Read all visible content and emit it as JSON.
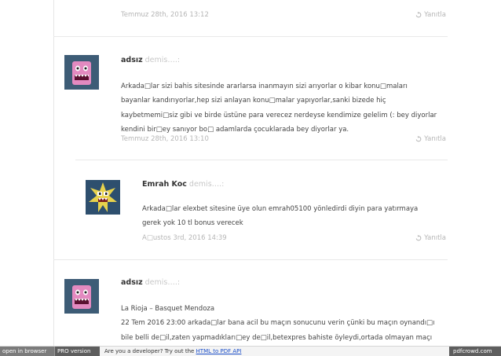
{
  "comments": [
    {
      "date": "Temmuz 28th, 2016 13:12",
      "reply_label": "Yanıtla"
    },
    {
      "author": "adsız",
      "mention": "demis….:",
      "lines": [
        "Arkada□lar sizi bahis sitesinde ararlarsa inanmayın sizi arıyorlar o kibar konu□maları",
        "bayanlar kandırıyorlar,hep sizi anlayan konu□malar yapıyorlar,sanki bizede hiç",
        "kaybetmemi□siz gibi ve birde üstüne para verecez nerdeyse kendimize gelelim (: bey diyorlar",
        "kendini bir□ey sanıyor bo□ adamlarda çocuklarada bey diyorlar ya."
      ],
      "date": "Temmuz 28th, 2016 13:10",
      "reply_label": "Yanıtla"
    },
    {
      "author": "Emrah Koc",
      "mention": "demis….:",
      "lines": [
        "Arkada□lar elexbet sitesine üye olun emrah05100 yönledirdi diyin para yatırmaya",
        "gerek yok 10 tl bonus verecek"
      ],
      "date": "A□ustos 3rd, 2016 14:39",
      "reply_label": "Yanıtla"
    },
    {
      "author": "adsız",
      "mention": "demis….:",
      "lines": [
        "La Rioja – Basquet Mendoza",
        "22 Tem 2016 23:00 arkada□lar bana acil bu maçın sonucunu verin çünki bu maçın oynandı□ı",
        "bile belli de□il,zaten yapmadıkları□ey de□il,betexpres bahiste öyleydi,ortada olmayan maçı"
      ]
    }
  ],
  "footer": {
    "open_label": "open in browser",
    "pro_label": "PRO version",
    "dev_text": "Are you a developer? Try out the ",
    "dev_link": "HTML to PDF API",
    "brand": "pdfcrowd.com"
  },
  "colors": {
    "meta_gray": "#b6b6b6",
    "link_blue": "#1a4ec9",
    "avatar_pink": "#e38ac0"
  }
}
